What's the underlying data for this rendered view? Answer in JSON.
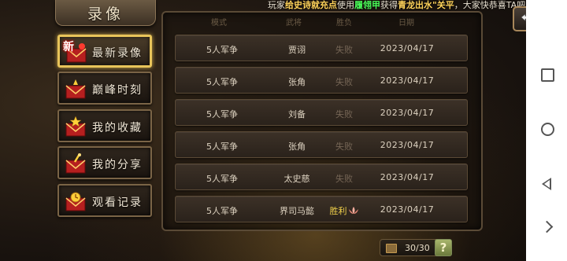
{
  "broadcast": {
    "prefix": "玩家",
    "player": "给史诗就充点",
    "mid1": "使用",
    "item": "履翎甲",
    "mid2": "获得",
    "reward": "青龙出水\"关平",
    "suffix": "，大家快恭喜TA吧"
  },
  "title": "录像",
  "menu": [
    {
      "label": "最新录像",
      "tag": "新",
      "icon": "envelope-new-icon",
      "active": true
    },
    {
      "label": "巅峰时刻",
      "icon": "envelope-peak-icon",
      "active": false
    },
    {
      "label": "我的收藏",
      "icon": "envelope-star-icon",
      "active": false
    },
    {
      "label": "我的分享",
      "icon": "envelope-share-icon",
      "active": false
    },
    {
      "label": "观看记录",
      "icon": "envelope-history-icon",
      "active": false
    }
  ],
  "table": {
    "headers": [
      "模式",
      "武将",
      "胜负",
      "日期"
    ],
    "rows": [
      {
        "mode": "5人军争",
        "general": "贾诩",
        "result": "失败",
        "date": "2023/04/17",
        "win": false
      },
      {
        "mode": "5人军争",
        "general": "张角",
        "result": "失败",
        "date": "2023/04/17",
        "win": false
      },
      {
        "mode": "5人军争",
        "general": "刘备",
        "result": "失败",
        "date": "2023/04/17",
        "win": false
      },
      {
        "mode": "5人军争",
        "general": "张角",
        "result": "失败",
        "date": "2023/04/17",
        "win": false
      },
      {
        "mode": "5人军争",
        "general": "太史慈",
        "result": "失败",
        "date": "2023/04/17",
        "win": false
      },
      {
        "mode": "5人军争",
        "general": "界司马懿",
        "result": "胜利",
        "date": "2023/04/17",
        "win": true
      }
    ]
  },
  "pager": {
    "text": "30/30",
    "help": "?"
  },
  "colors": {
    "gold": "#e8c45a",
    "win": "#f0d04a",
    "lose": "#766656",
    "highlight_green": "#4cff5a"
  }
}
